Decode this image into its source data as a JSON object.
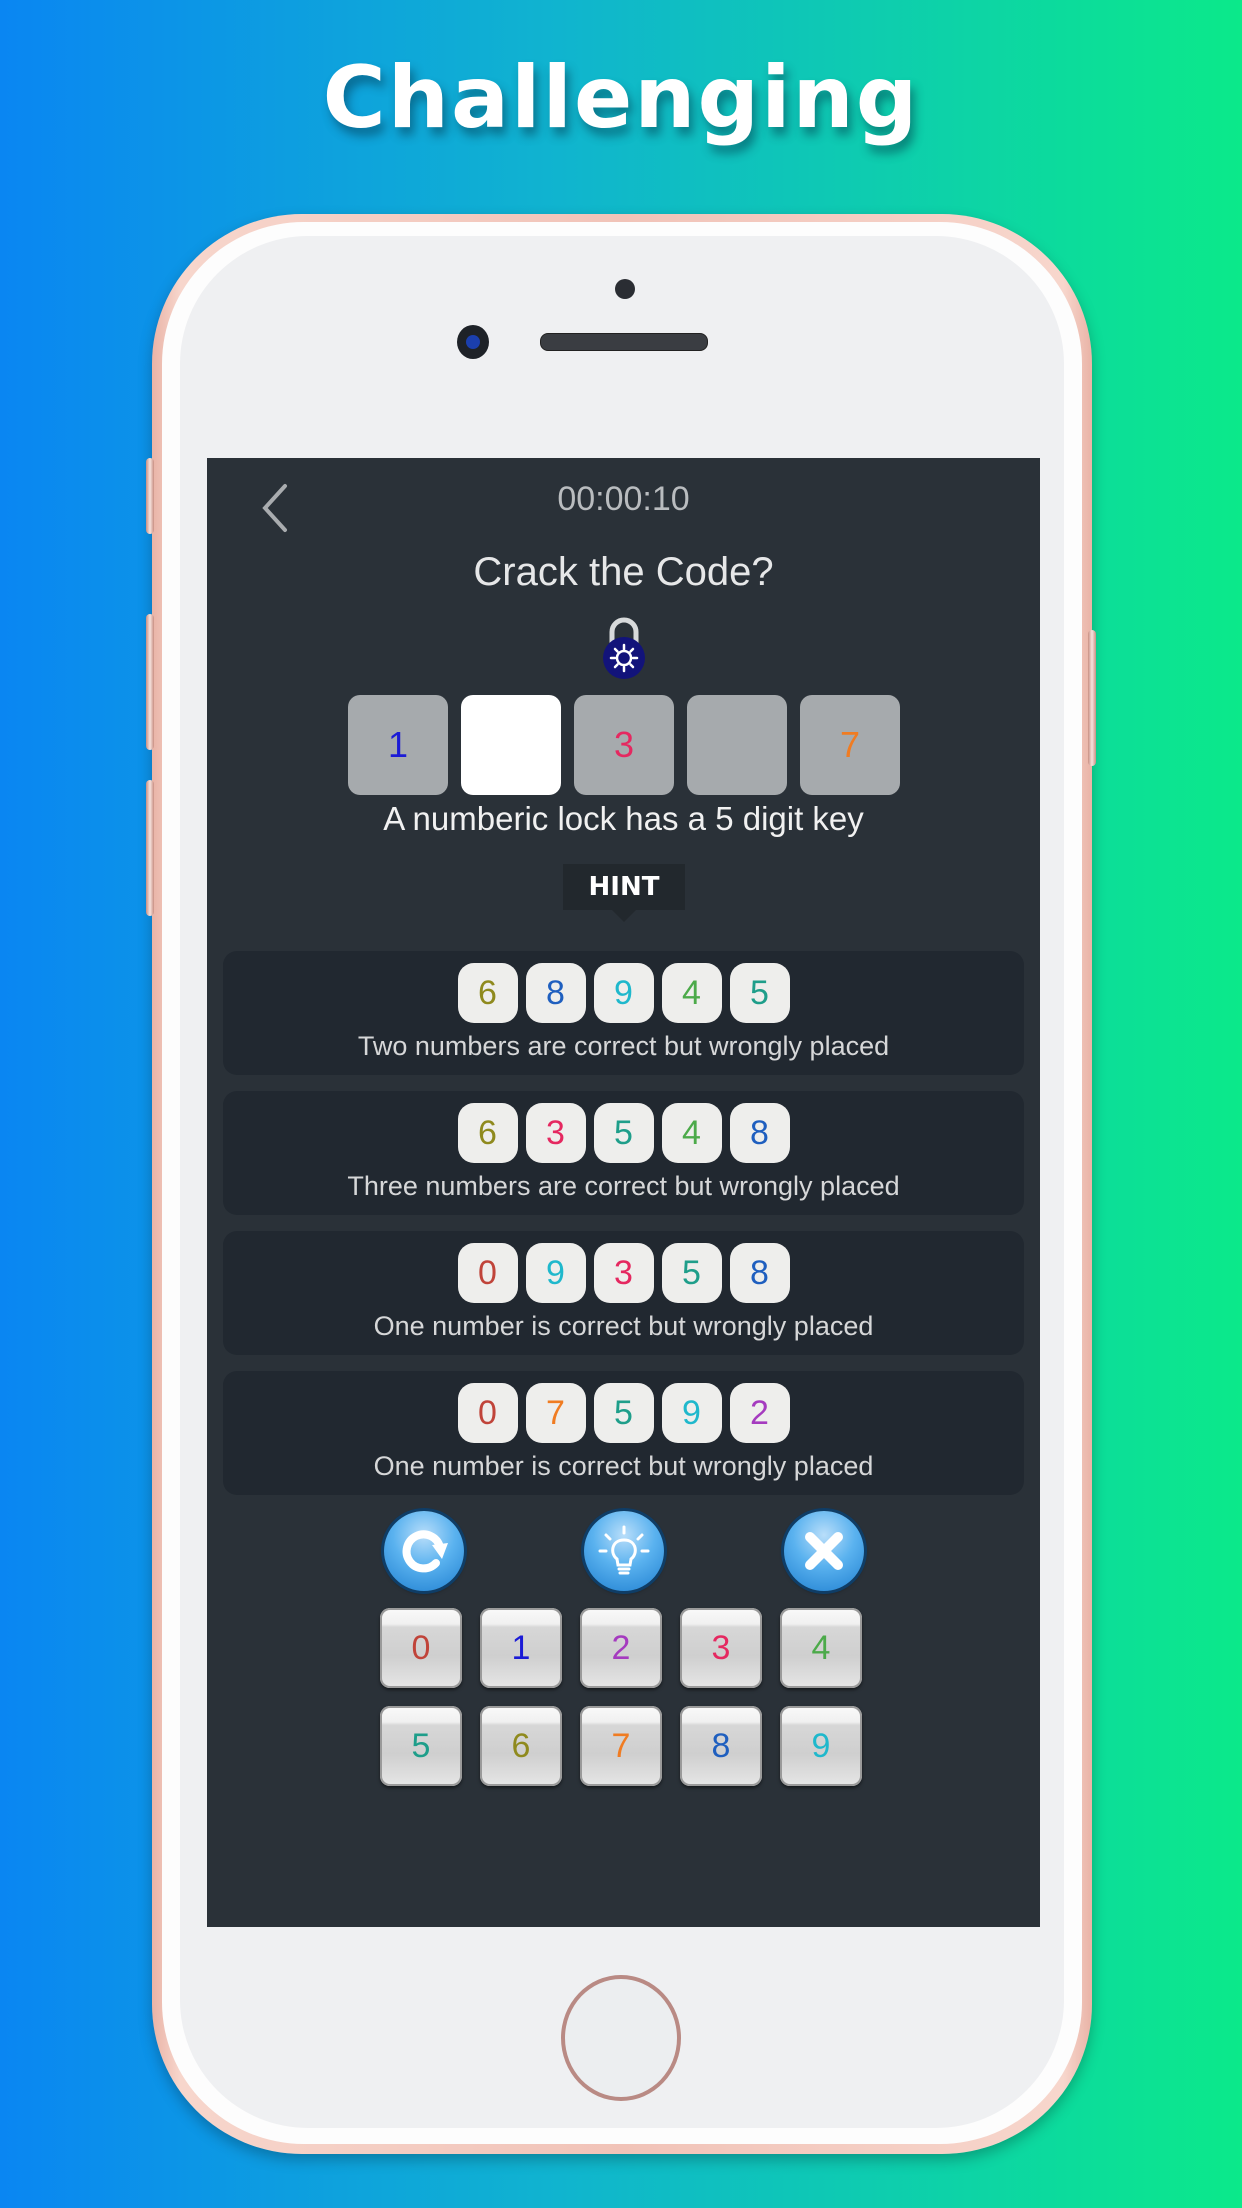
{
  "headline": "Challenging",
  "screen": {
    "timer": "00:00:10",
    "title": "Crack the Code?",
    "slots": [
      {
        "value": "1",
        "color": "#1b1bd6",
        "active": false
      },
      {
        "value": "",
        "color": "#000000",
        "active": true
      },
      {
        "value": "3",
        "color": "#e52860",
        "active": false
      },
      {
        "value": "",
        "color": "#000000",
        "active": false
      },
      {
        "value": "7",
        "color": "#f07c22",
        "active": false
      }
    ],
    "description": "A numberic lock has a 5 digit key",
    "hint_label": "HINT",
    "clues": [
      {
        "digits": [
          "6",
          "8",
          "9",
          "4",
          "5"
        ],
        "text": "Two numbers are correct but wrongly placed"
      },
      {
        "digits": [
          "6",
          "3",
          "5",
          "4",
          "8"
        ],
        "text": "Three numbers are correct but wrongly placed"
      },
      {
        "digits": [
          "0",
          "9",
          "3",
          "5",
          "8"
        ],
        "text": "One number is correct but wrongly placed"
      },
      {
        "digits": [
          "0",
          "7",
          "5",
          "9",
          "2"
        ],
        "text": "One number is correct but wrongly placed"
      }
    ],
    "actions": [
      {
        "name": "reset-button",
        "icon": "refresh-icon"
      },
      {
        "name": "hint-button",
        "icon": "lightbulb-icon"
      },
      {
        "name": "clear-button",
        "icon": "close-icon"
      }
    ],
    "keypad": [
      "0",
      "1",
      "2",
      "3",
      "4",
      "5",
      "6",
      "7",
      "8",
      "9"
    ]
  },
  "digit_colors": {
    "0": "#c0443a",
    "1": "#1b1bd6",
    "2": "#a53bbf",
    "3": "#e52860",
    "4": "#4caa4a",
    "5": "#1e9e8a",
    "6": "#8f8a1e",
    "7": "#f07c22",
    "8": "#1f5fbf",
    "9": "#1fb8cc"
  }
}
